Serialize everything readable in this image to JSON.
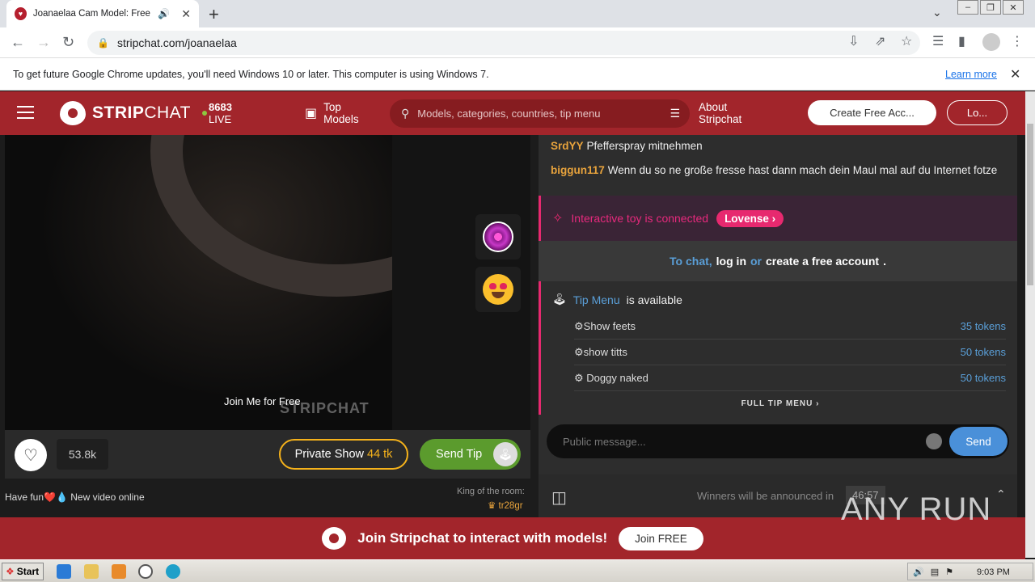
{
  "browser": {
    "tab_title": "Joanaelaa Cam Model: Free Live",
    "url": "stripchat.com/joanaelaa",
    "infobar_text": "To get future Google Chrome updates, you'll need Windows 10 or later. This computer is using Windows 7.",
    "infobar_link": "Learn more"
  },
  "header": {
    "logo_bold": "STRIP",
    "logo_regular": "CHAT",
    "live_count": "8683",
    "live_label": "LIVE",
    "top_models_line1": "Top",
    "top_models_line2": "Models",
    "search_placeholder": "Models, categories, countries, tip menu",
    "about_line1": "About",
    "about_line2": "Stripchat",
    "create_account": "Create Free Acc...",
    "login": "Lo..."
  },
  "video": {
    "overlay_text": "Join Me for Free",
    "watermark": "STRIPCHAT"
  },
  "video_bar": {
    "likes": "53.8k",
    "private_show_label": "Private Show",
    "private_show_price": "44 tk",
    "send_tip_label": "Send Tip"
  },
  "room": {
    "bio": "Have fun❤️💧 New video online",
    "king_label": "King of the room:",
    "king_user": "tr28gr"
  },
  "chat": {
    "messages": [
      {
        "user": "SrdYY",
        "text": "Pfefferspray mitnehmen"
      },
      {
        "user": "biggun117",
        "text": "Wenn du so ne große fresse hast dann mach dein Maul mal auf du Internet fotze"
      }
    ],
    "toy_text": "Interactive toy is connected",
    "toy_brand": "Lovense",
    "to_chat": "To chat,",
    "log_in": "log in",
    "or": "or",
    "create_account": "create a free account",
    "tip_menu_link": "Tip Menu",
    "tip_menu_suffix": "is available",
    "tip_items": [
      {
        "label": "Show feets",
        "tokens": "35 tokens"
      },
      {
        "label": "show titts",
        "tokens": "50 tokens"
      },
      {
        "label": " Doggy naked",
        "tokens": "50 tokens"
      }
    ],
    "full_tip_menu": "FULL TIP MENU",
    "composer_placeholder": "Public message...",
    "send_label": "Send",
    "winners_text": "Winners will be announced in",
    "winners_timer": "46:57"
  },
  "join_bar": {
    "text": "Join Stripchat to interact with models!",
    "button": "Join FREE"
  },
  "watermark_brand": "ANY RUN",
  "taskbar": {
    "start_label": "Start",
    "clock": "9:03 PM"
  }
}
